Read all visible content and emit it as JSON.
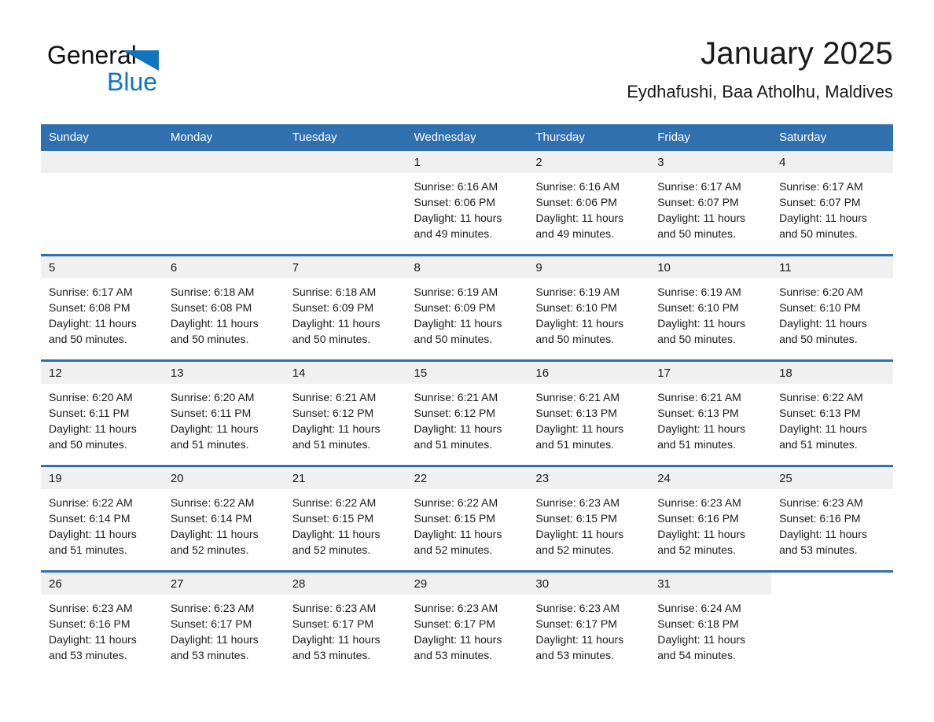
{
  "brand": {
    "name_part1": "General",
    "name_part2": "Blue"
  },
  "header": {
    "title": "January 2025",
    "subtitle": "Eydhafushi, Baa Atholhu, Maldives"
  },
  "colors": {
    "header_blue": "#3070AF",
    "logo_blue": "#1274BC",
    "daynum_strip": "#f0f0f0",
    "page_background": "#ffffff"
  },
  "weekday_headers": [
    "Sunday",
    "Monday",
    "Tuesday",
    "Wednesday",
    "Thursday",
    "Friday",
    "Saturday"
  ],
  "labels": {
    "sunrise_prefix": "Sunrise: ",
    "sunset_prefix": "Sunset: ",
    "daylight_prefix": "Daylight: "
  },
  "weeks": [
    [
      {
        "day": "",
        "empty": true
      },
      {
        "day": "",
        "empty": true
      },
      {
        "day": "",
        "empty": true
      },
      {
        "day": "1",
        "sunrise": "Sunrise: 6:16 AM",
        "sunset": "Sunset: 6:06 PM",
        "daylight_l1": "Daylight: 11 hours",
        "daylight_l2": "and 49 minutes."
      },
      {
        "day": "2",
        "sunrise": "Sunrise: 6:16 AM",
        "sunset": "Sunset: 6:06 PM",
        "daylight_l1": "Daylight: 11 hours",
        "daylight_l2": "and 49 minutes."
      },
      {
        "day": "3",
        "sunrise": "Sunrise: 6:17 AM",
        "sunset": "Sunset: 6:07 PM",
        "daylight_l1": "Daylight: 11 hours",
        "daylight_l2": "and 50 minutes."
      },
      {
        "day": "4",
        "sunrise": "Sunrise: 6:17 AM",
        "sunset": "Sunset: 6:07 PM",
        "daylight_l1": "Daylight: 11 hours",
        "daylight_l2": "and 50 minutes."
      }
    ],
    [
      {
        "day": "5",
        "sunrise": "Sunrise: 6:17 AM",
        "sunset": "Sunset: 6:08 PM",
        "daylight_l1": "Daylight: 11 hours",
        "daylight_l2": "and 50 minutes."
      },
      {
        "day": "6",
        "sunrise": "Sunrise: 6:18 AM",
        "sunset": "Sunset: 6:08 PM",
        "daylight_l1": "Daylight: 11 hours",
        "daylight_l2": "and 50 minutes."
      },
      {
        "day": "7",
        "sunrise": "Sunrise: 6:18 AM",
        "sunset": "Sunset: 6:09 PM",
        "daylight_l1": "Daylight: 11 hours",
        "daylight_l2": "and 50 minutes."
      },
      {
        "day": "8",
        "sunrise": "Sunrise: 6:19 AM",
        "sunset": "Sunset: 6:09 PM",
        "daylight_l1": "Daylight: 11 hours",
        "daylight_l2": "and 50 minutes."
      },
      {
        "day": "9",
        "sunrise": "Sunrise: 6:19 AM",
        "sunset": "Sunset: 6:10 PM",
        "daylight_l1": "Daylight: 11 hours",
        "daylight_l2": "and 50 minutes."
      },
      {
        "day": "10",
        "sunrise": "Sunrise: 6:19 AM",
        "sunset": "Sunset: 6:10 PM",
        "daylight_l1": "Daylight: 11 hours",
        "daylight_l2": "and 50 minutes."
      },
      {
        "day": "11",
        "sunrise": "Sunrise: 6:20 AM",
        "sunset": "Sunset: 6:10 PM",
        "daylight_l1": "Daylight: 11 hours",
        "daylight_l2": "and 50 minutes."
      }
    ],
    [
      {
        "day": "12",
        "sunrise": "Sunrise: 6:20 AM",
        "sunset": "Sunset: 6:11 PM",
        "daylight_l1": "Daylight: 11 hours",
        "daylight_l2": "and 50 minutes."
      },
      {
        "day": "13",
        "sunrise": "Sunrise: 6:20 AM",
        "sunset": "Sunset: 6:11 PM",
        "daylight_l1": "Daylight: 11 hours",
        "daylight_l2": "and 51 minutes."
      },
      {
        "day": "14",
        "sunrise": "Sunrise: 6:21 AM",
        "sunset": "Sunset: 6:12 PM",
        "daylight_l1": "Daylight: 11 hours",
        "daylight_l2": "and 51 minutes."
      },
      {
        "day": "15",
        "sunrise": "Sunrise: 6:21 AM",
        "sunset": "Sunset: 6:12 PM",
        "daylight_l1": "Daylight: 11 hours",
        "daylight_l2": "and 51 minutes."
      },
      {
        "day": "16",
        "sunrise": "Sunrise: 6:21 AM",
        "sunset": "Sunset: 6:13 PM",
        "daylight_l1": "Daylight: 11 hours",
        "daylight_l2": "and 51 minutes."
      },
      {
        "day": "17",
        "sunrise": "Sunrise: 6:21 AM",
        "sunset": "Sunset: 6:13 PM",
        "daylight_l1": "Daylight: 11 hours",
        "daylight_l2": "and 51 minutes."
      },
      {
        "day": "18",
        "sunrise": "Sunrise: 6:22 AM",
        "sunset": "Sunset: 6:13 PM",
        "daylight_l1": "Daylight: 11 hours",
        "daylight_l2": "and 51 minutes."
      }
    ],
    [
      {
        "day": "19",
        "sunrise": "Sunrise: 6:22 AM",
        "sunset": "Sunset: 6:14 PM",
        "daylight_l1": "Daylight: 11 hours",
        "daylight_l2": "and 51 minutes."
      },
      {
        "day": "20",
        "sunrise": "Sunrise: 6:22 AM",
        "sunset": "Sunset: 6:14 PM",
        "daylight_l1": "Daylight: 11 hours",
        "daylight_l2": "and 52 minutes."
      },
      {
        "day": "21",
        "sunrise": "Sunrise: 6:22 AM",
        "sunset": "Sunset: 6:15 PM",
        "daylight_l1": "Daylight: 11 hours",
        "daylight_l2": "and 52 minutes."
      },
      {
        "day": "22",
        "sunrise": "Sunrise: 6:22 AM",
        "sunset": "Sunset: 6:15 PM",
        "daylight_l1": "Daylight: 11 hours",
        "daylight_l2": "and 52 minutes."
      },
      {
        "day": "23",
        "sunrise": "Sunrise: 6:23 AM",
        "sunset": "Sunset: 6:15 PM",
        "daylight_l1": "Daylight: 11 hours",
        "daylight_l2": "and 52 minutes."
      },
      {
        "day": "24",
        "sunrise": "Sunrise: 6:23 AM",
        "sunset": "Sunset: 6:16 PM",
        "daylight_l1": "Daylight: 11 hours",
        "daylight_l2": "and 52 minutes."
      },
      {
        "day": "25",
        "sunrise": "Sunrise: 6:23 AM",
        "sunset": "Sunset: 6:16 PM",
        "daylight_l1": "Daylight: 11 hours",
        "daylight_l2": "and 53 minutes."
      }
    ],
    [
      {
        "day": "26",
        "sunrise": "Sunrise: 6:23 AM",
        "sunset": "Sunset: 6:16 PM",
        "daylight_l1": "Daylight: 11 hours",
        "daylight_l2": "and 53 minutes."
      },
      {
        "day": "27",
        "sunrise": "Sunrise: 6:23 AM",
        "sunset": "Sunset: 6:17 PM",
        "daylight_l1": "Daylight: 11 hours",
        "daylight_l2": "and 53 minutes."
      },
      {
        "day": "28",
        "sunrise": "Sunrise: 6:23 AM",
        "sunset": "Sunset: 6:17 PM",
        "daylight_l1": "Daylight: 11 hours",
        "daylight_l2": "and 53 minutes."
      },
      {
        "day": "29",
        "sunrise": "Sunrise: 6:23 AM",
        "sunset": "Sunset: 6:17 PM",
        "daylight_l1": "Daylight: 11 hours",
        "daylight_l2": "and 53 minutes."
      },
      {
        "day": "30",
        "sunrise": "Sunrise: 6:23 AM",
        "sunset": "Sunset: 6:17 PM",
        "daylight_l1": "Daylight: 11 hours",
        "daylight_l2": "and 53 minutes."
      },
      {
        "day": "31",
        "sunrise": "Sunrise: 6:24 AM",
        "sunset": "Sunset: 6:18 PM",
        "daylight_l1": "Daylight: 11 hours",
        "daylight_l2": "and 54 minutes."
      },
      {
        "day": "",
        "empty": true,
        "blank": true
      }
    ]
  ]
}
